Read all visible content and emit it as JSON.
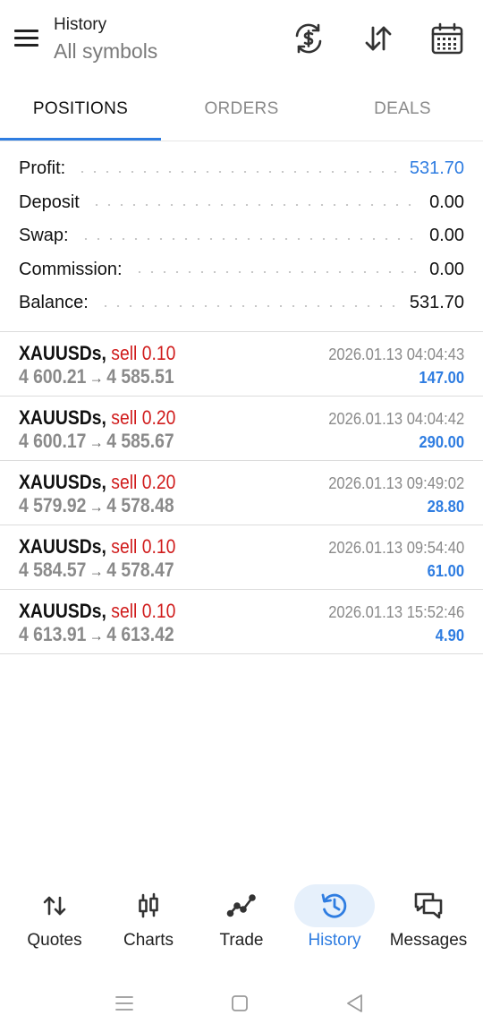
{
  "header": {
    "title": "History",
    "subtitle": "All symbols"
  },
  "tabs": [
    {
      "label": "POSITIONS",
      "active": true
    },
    {
      "label": "ORDERS",
      "active": false
    },
    {
      "label": "DEALS",
      "active": false
    }
  ],
  "summary": [
    {
      "label": "Profit:",
      "value": "531.70",
      "highlight": true
    },
    {
      "label": "Deposit",
      "value": "0.00",
      "highlight": false
    },
    {
      "label": "Swap:",
      "value": "0.00",
      "highlight": false
    },
    {
      "label": "Commission:",
      "value": "0.00",
      "highlight": false
    },
    {
      "label": "Balance:",
      "value": "531.70",
      "highlight": false
    }
  ],
  "deals": [
    {
      "symbol": "XAUUSDs,",
      "side": "sell 0.10",
      "open_price": "4 600.21",
      "arrow": "→",
      "close_price": "4 585.51",
      "time": "2026.01.13 04:04:43",
      "profit": "147.00"
    },
    {
      "symbol": "XAUUSDs,",
      "side": "sell 0.20",
      "open_price": "4 600.17",
      "arrow": "→",
      "close_price": "4 585.67",
      "time": "2026.01.13 04:04:42",
      "profit": "290.00"
    },
    {
      "symbol": "XAUUSDs,",
      "side": "sell 0.20",
      "open_price": "4 579.92",
      "arrow": "→",
      "close_price": "4 578.48",
      "time": "2026.01.13 09:49:02",
      "profit": "28.80"
    },
    {
      "symbol": "XAUUSDs,",
      "side": "sell 0.10",
      "open_price": "4 584.57",
      "arrow": "→",
      "close_price": "4 578.47",
      "time": "2026.01.13 09:54:40",
      "profit": "61.00"
    },
    {
      "symbol": "XAUUSDs,",
      "side": "sell 0.10",
      "open_price": "4 613.91",
      "arrow": "→",
      "close_price": "4 613.42",
      "time": "2026.01.13 15:52:46",
      "profit": "4.90"
    }
  ],
  "bottom_nav": [
    {
      "label": "Quotes",
      "icon": "quotes-icon",
      "active": false
    },
    {
      "label": "Charts",
      "icon": "charts-icon",
      "active": false
    },
    {
      "label": "Trade",
      "icon": "trade-icon",
      "active": false
    },
    {
      "label": "History",
      "icon": "history-icon",
      "active": true
    },
    {
      "label": "Messages",
      "icon": "messages-icon",
      "active": false
    }
  ],
  "colors": {
    "accent": "#2f7de1",
    "sell": "#d01c1c",
    "muted": "#8a8a8a",
    "active_nav_bg": "#e6f0fb"
  }
}
